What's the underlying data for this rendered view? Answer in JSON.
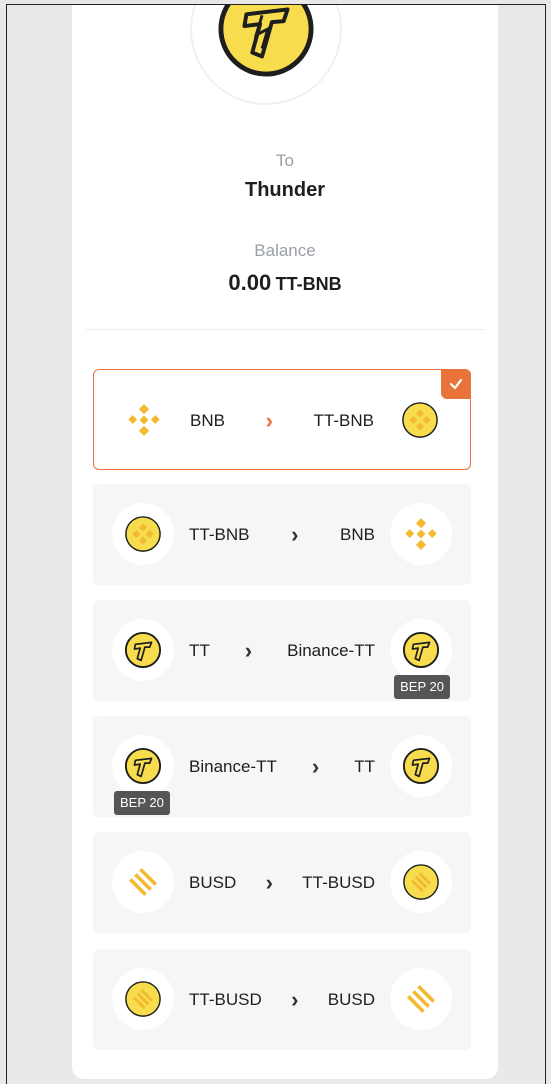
{
  "header": {
    "to_label": "To",
    "to_value": "Thunder",
    "balance_label": "Balance",
    "balance_amount": "0.00",
    "balance_unit": "TT-BNB"
  },
  "colors": {
    "accent": "#e8743b",
    "coin_yellow": "#f7dd4e",
    "binance_gold": "#f3ba2f"
  },
  "options": [
    {
      "from": "BNB",
      "to": "TT-BNB",
      "selected": true,
      "left_icon": "bnb-icon",
      "right_icon": "tt-bnb-icon",
      "left_badge": "",
      "right_badge": ""
    },
    {
      "from": "TT-BNB",
      "to": "BNB",
      "selected": false,
      "left_icon": "tt-bnb-icon",
      "right_icon": "bnb-icon",
      "left_badge": "",
      "right_badge": ""
    },
    {
      "from": "TT",
      "to": "Binance-TT",
      "selected": false,
      "left_icon": "thunder-icon",
      "right_icon": "thunder-icon",
      "left_badge": "",
      "right_badge": "BEP 20"
    },
    {
      "from": "Binance-TT",
      "to": "TT",
      "selected": false,
      "left_icon": "thunder-icon",
      "right_icon": "thunder-icon",
      "left_badge": "BEP 20",
      "right_badge": ""
    },
    {
      "from": "BUSD",
      "to": "TT-BUSD",
      "selected": false,
      "left_icon": "busd-icon",
      "right_icon": "tt-busd-icon",
      "left_badge": "",
      "right_badge": ""
    },
    {
      "from": "TT-BUSD",
      "to": "BUSD",
      "selected": false,
      "left_icon": "tt-busd-icon",
      "right_icon": "busd-icon",
      "left_badge": "",
      "right_badge": ""
    }
  ]
}
